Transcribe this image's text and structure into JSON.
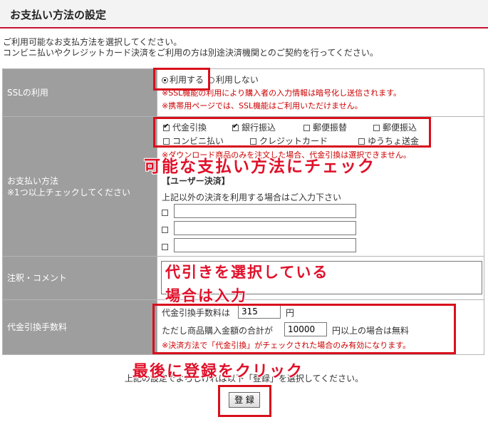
{
  "header": {
    "title": "お支払い方法の設定"
  },
  "intro": {
    "line1": "ご利用可能なお支払方法を選択してください。",
    "line2": "コンビニ払いやクレジットカード決済をご利用の方は別途決済機関とのご契約を行ってください。"
  },
  "ssl": {
    "label": "SSLの利用",
    "options": [
      {
        "label": "利用する",
        "selected": true
      },
      {
        "label": "利用しない",
        "selected": false
      }
    ],
    "note1": "※SSL機能の利用により購入者の入力情報は暗号化し送信されます。",
    "note2": "※携帯用ページでは、SSL機能はご利用いただけません。"
  },
  "payment": {
    "label": "お支払い方法",
    "sublabel": "※1つ以上チェックしてください",
    "methods": [
      {
        "label": "代金引換",
        "checked": true
      },
      {
        "label": "銀行振込",
        "checked": true
      },
      {
        "label": "郵便振替",
        "checked": false
      },
      {
        "label": "郵便振込",
        "checked": false
      },
      {
        "label": "コンビニ払い",
        "checked": false
      },
      {
        "label": "クレジットカード",
        "checked": false
      },
      {
        "label": "ゆうちょ送金",
        "checked": false
      }
    ],
    "note": "※ダウンロード商品のみを注文した場合、代金引換は選択できません。",
    "user_section_title": "【ユーザー決済】",
    "user_section_desc": "上記以外の決済を利用する場合はご入力下さい",
    "user_fields": [
      "",
      "",
      ""
    ]
  },
  "comment": {
    "label": "注釈・コメント",
    "value": ""
  },
  "cod_fee": {
    "label": "代金引換手数料",
    "fee_prefix": "代金引換手数料は",
    "fee_value": "315",
    "fee_unit": "円",
    "free_prefix": "ただし商品購入金額の合計が",
    "free_value": "10000",
    "free_suffix": "円以上の場合は無料",
    "note": "※決済方法で「代金引換」がチェックされた場合のみ有効になります。"
  },
  "footer": {
    "text": "上記の設定でよろしければ以下「登録」を選択してください。"
  },
  "submit": {
    "label": "登 録"
  },
  "annotations": {
    "payment": "可能な支払い方法にチェック",
    "comment_line1": "代引きを選択している",
    "comment_line2": "場合は入力",
    "submit": "最後に登録をクリック"
  },
  "colors": {
    "accent": "#d8101c",
    "label_bg": "#9e9e9e",
    "note": "#cc0000"
  }
}
